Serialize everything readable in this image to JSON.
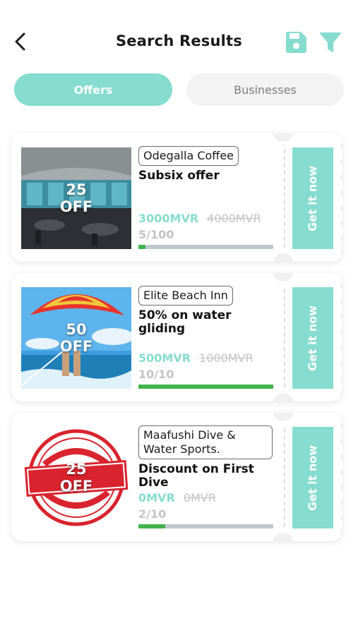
{
  "header": {
    "title": "Search Results"
  },
  "tabs": [
    {
      "label": "Offers",
      "active": true
    },
    {
      "label": "Businesses",
      "active": false
    }
  ],
  "colors": {
    "accent": "#86dccf",
    "progress_fill": "#41b34a",
    "progress_track": "#bfc8cc"
  },
  "offers": [
    {
      "business": "Odegalla Coffee",
      "title": "Subsix offer",
      "discount_value": "25",
      "discount_label": "OFF",
      "price": "3000MVR",
      "original_price": "4000MVR",
      "quantity": "5/100",
      "claimed_fraction": 0.05,
      "cta": "Get it now"
    },
    {
      "business": "Elite Beach Inn",
      "title": "50% on water gliding",
      "discount_value": "50",
      "discount_label": "OFF",
      "price": "500MVR",
      "original_price": "1000MVR",
      "quantity": "10/10",
      "claimed_fraction": 1.0,
      "cta": "Get it now"
    },
    {
      "business": "Maafushi Dive & Water Sports.",
      "title": "Discount on First Dive",
      "discount_value": "25",
      "discount_label": "OFF",
      "price": "0MVR",
      "original_price": "0MVR",
      "quantity": "2/10",
      "claimed_fraction": 0.2,
      "cta": "Get it now"
    }
  ]
}
